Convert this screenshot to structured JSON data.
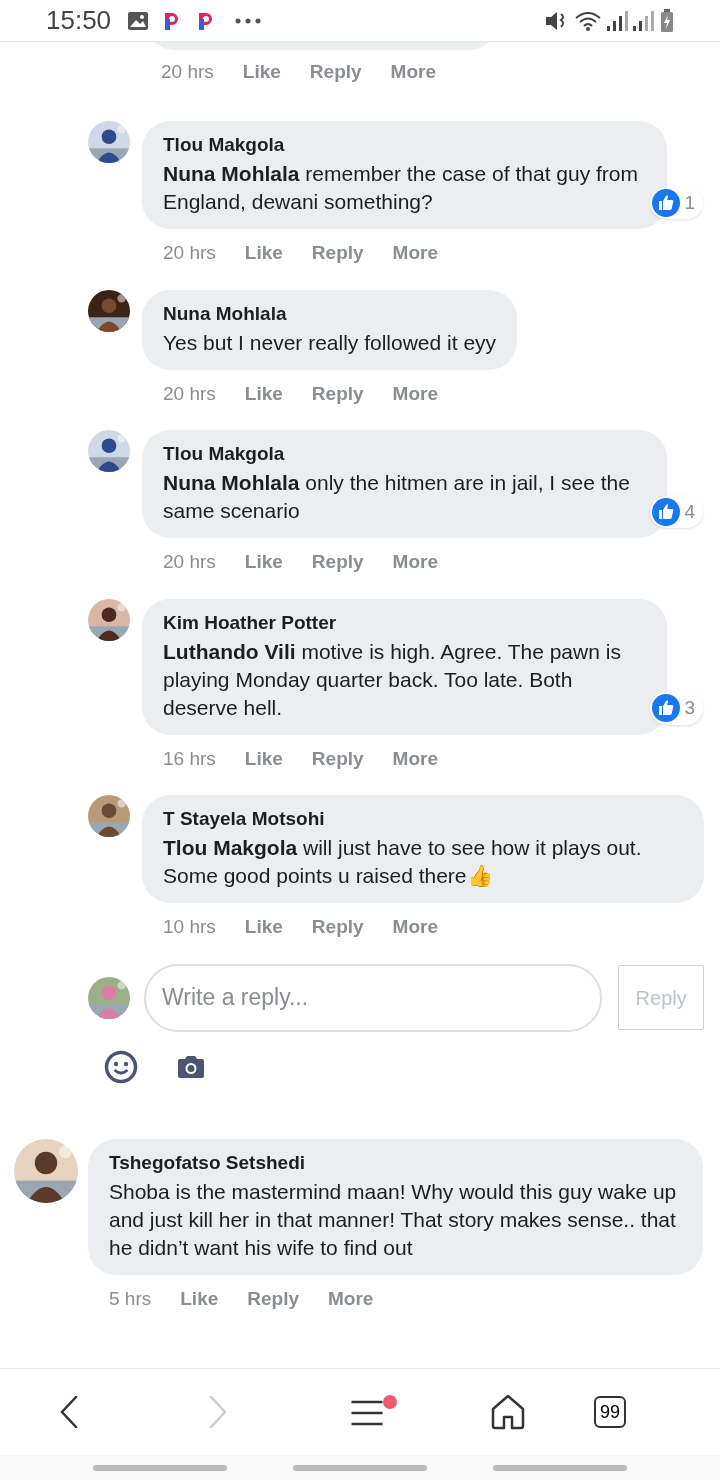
{
  "status_bar": {
    "time": "15:50"
  },
  "partial_comment": {
    "time": "20 hrs",
    "actions": [
      "Like",
      "Reply",
      "More"
    ]
  },
  "replies": [
    {
      "author": "Tlou Makgola",
      "mention": "Nuna Mohlala",
      "text": "remember the case of that guy from England, dewani something?",
      "time": "20 hrs",
      "actions": [
        "Like",
        "Reply",
        "More"
      ],
      "reactions": "1"
    },
    {
      "author": "Nuna Mohlala",
      "text": "Yes but I never really followed it eyy",
      "time": "20 hrs",
      "actions": [
        "Like",
        "Reply",
        "More"
      ]
    },
    {
      "author": "Tlou Makgola",
      "mention": "Nuna Mohlala",
      "text": "only the hitmen are in jail, I see the same scenario",
      "time": "20 hrs",
      "actions": [
        "Like",
        "Reply",
        "More"
      ],
      "reactions": "4"
    },
    {
      "author": "Kim Hoather Potter",
      "mention": "Luthando Vili",
      "text": "motive is high. Agree. The pawn is playing Monday quarter back. Too late. Both deserve hell.",
      "time": "16 hrs",
      "actions": [
        "Like",
        "Reply",
        "More"
      ],
      "reactions": "3"
    },
    {
      "author": "T Stayela Motsohi",
      "mention": "Tlou Makgola",
      "text": "will just have to see how it plays out. Some good points u raised there👍",
      "time": "10 hrs",
      "actions": [
        "Like",
        "Reply",
        "More"
      ]
    }
  ],
  "reply_box": {
    "placeholder": "Write a reply...",
    "button": "Reply"
  },
  "comments": [
    {
      "author": "Tshegofatso Setshedi",
      "text": "Shoba is the mastermind maan! Why would this guy wake up and just kill her in that manner! That story makes sense.. that he didn’t want his wife to find out",
      "time": "5 hrs",
      "actions": [
        "Like",
        "Reply",
        "More"
      ]
    }
  ],
  "browser_nav": {
    "tabs_count": "99",
    "menu_badge": true
  }
}
